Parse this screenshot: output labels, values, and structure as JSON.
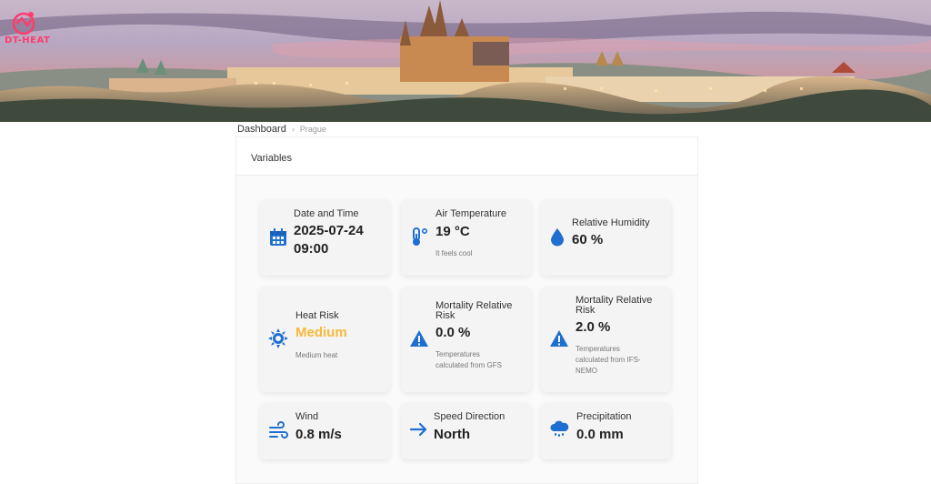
{
  "brand": {
    "logo_text": "DT-HEAT",
    "accent": "#ff3b6f"
  },
  "breadcrumb": {
    "current": "Dashboard",
    "sub": "Prague",
    "separator": "›"
  },
  "panel": {
    "title": "Variables"
  },
  "colors": {
    "icon_blue": "#1f6fd1",
    "heat_value": "#f5b93c"
  },
  "cards": {
    "datetime": {
      "label": "Date and Time",
      "date": "2025-07-24",
      "time": "09:00",
      "icon": "calendar-icon"
    },
    "air_temp": {
      "label": "Air Temperature",
      "value": "19 °C",
      "note": "It feels cool",
      "icon": "thermometer-icon"
    },
    "humidity": {
      "label": "Relative Humidity",
      "value": "60 %",
      "icon": "water-drop-icon"
    },
    "heat_risk": {
      "label": "Heat Risk",
      "value": "Medium",
      "note": "Medium heat",
      "icon": "sun-icon"
    },
    "mortality_gfs": {
      "label_l1": "Mortality Relative",
      "label_l2": "Risk",
      "value": "0.0 %",
      "note_l1": "Temperatures",
      "note_l2": "calculated from GFS",
      "icon": "warning-icon"
    },
    "mortality_ifs": {
      "label_l1": "Mortality Relative",
      "label_l2": "Risk",
      "value": "2.0 %",
      "note_l1": "Temperatures",
      "note_l2": "calculated from IFS-",
      "note_l3": "NEMO",
      "icon": "warning-icon"
    },
    "wind": {
      "label": "Wind",
      "value": "0.8 m/s",
      "icon": "wind-icon"
    },
    "direction": {
      "label": "Speed Direction",
      "value": "North",
      "icon": "arrow-right-icon"
    },
    "precipitation": {
      "label": "Precipitation",
      "value": "0.0 mm",
      "icon": "rain-cloud-icon"
    }
  }
}
